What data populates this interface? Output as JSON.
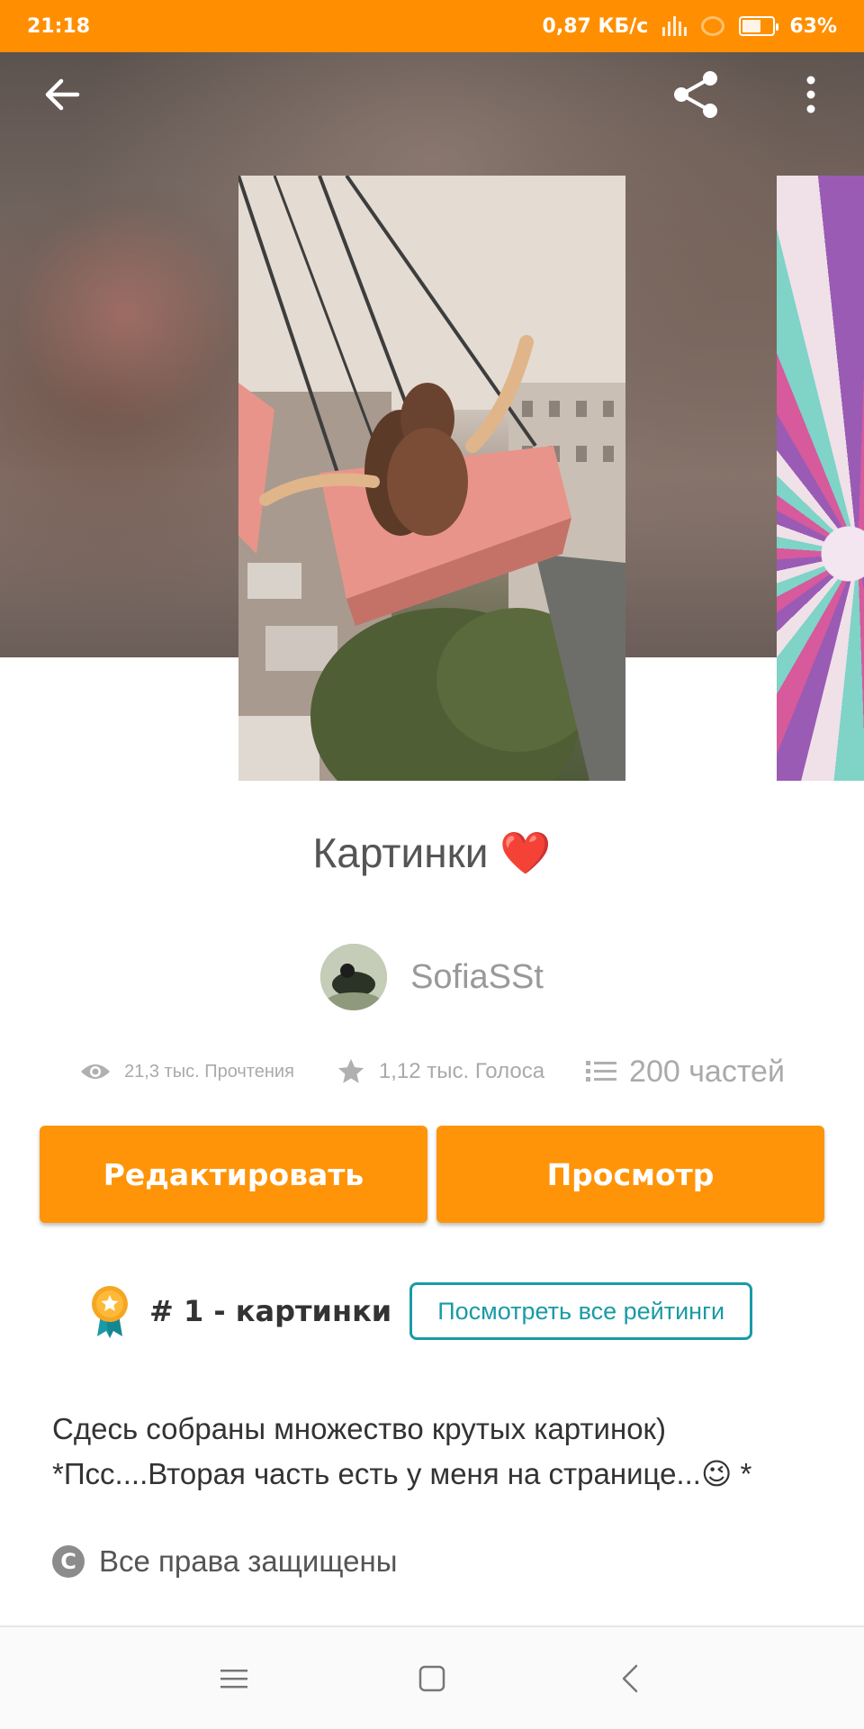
{
  "status_bar": {
    "time": "21:18",
    "net_speed": "0,87 КБ/с",
    "battery": "63%",
    "battery_level": 0.63
  },
  "toolbar": {
    "back_icon": "arrow-left-icon",
    "share_icon": "share-icon",
    "more_icon": "more-vertical-icon"
  },
  "story": {
    "title": "Картинки",
    "title_emoji": "❤️",
    "author": "SofiaSSt"
  },
  "stats": {
    "reads": "21,3 тыс. Прочтения",
    "votes": "1,12 тыс. Голоса",
    "parts": "200 частей"
  },
  "actions": {
    "edit_label": "Редактировать",
    "view_label": "Просмотр"
  },
  "ranking": {
    "rank_text": "# 1 - картинки",
    "all_ratings_label": "Посмотреть все рейтинги"
  },
  "description": {
    "line1": "Сдесь собраны множество крутых картинок)",
    "line2": "*Псс....Вторая часть есть у меня на странице...",
    "line2_emoji": "😉",
    "line2_end": " *"
  },
  "copyright": {
    "label": "Все права защищены"
  },
  "colors": {
    "accent": "#ff9408",
    "status_bar": "#ff8f00",
    "teal": "#1a9aa6"
  }
}
